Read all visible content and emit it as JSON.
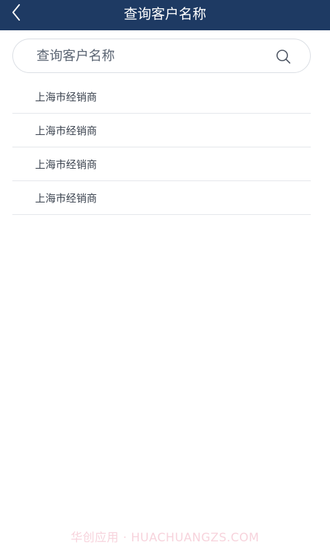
{
  "header": {
    "title": "查询客户名称",
    "back_icon": "chevron-left-icon"
  },
  "search": {
    "placeholder": "查询客户名称",
    "value": "",
    "icon": "search-icon"
  },
  "results": [
    {
      "label": "上海市经销商"
    },
    {
      "label": "上海市经销商"
    },
    {
      "label": "上海市经销商"
    },
    {
      "label": "上海市经销商"
    }
  ],
  "watermark": "华创应用 · HUACHUANGZS.COM",
  "colors": {
    "header_bg": "#1e3a63",
    "text": "#3c4450",
    "divider": "#e3e6ea",
    "watermark": "#f7d3dc"
  }
}
